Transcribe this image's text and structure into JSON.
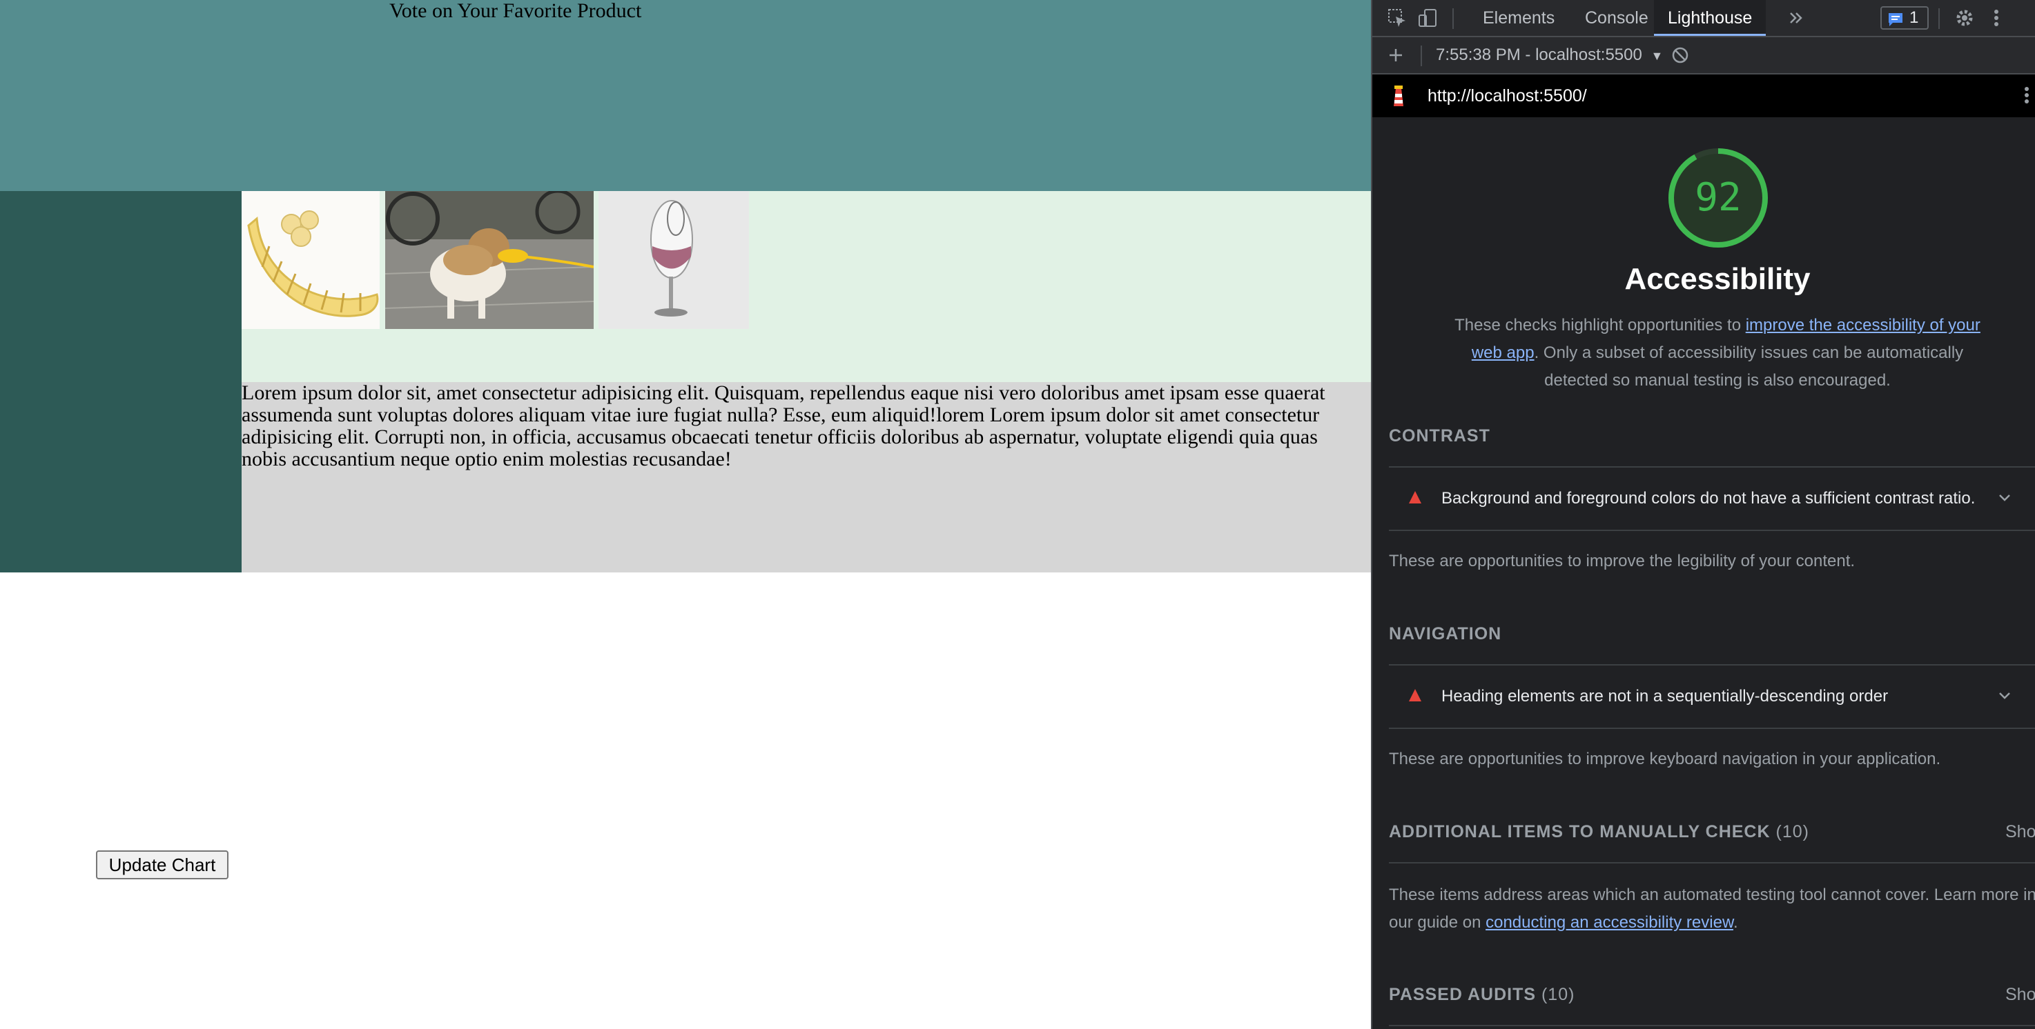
{
  "page": {
    "header_title": "Vote on Your Favorite Product",
    "products": [
      {
        "name": "banana-slicer-image",
        "icon": "banana-slicer-product-photo"
      },
      {
        "name": "duck-bill-dog-image",
        "icon": "dog-with-duck-bill-muzzle-photo"
      },
      {
        "name": "wine-glass-image",
        "icon": "tilted-wine-glass-product-photo"
      }
    ],
    "body_text": "Lorem ipsum dolor sit, amet consectetur adipisicing elit. Quisquam, repellendus eaque nisi vero doloribus amet ipsam esse quaerat assumenda sunt voluptas dolores aliquam vitae iure fugiat nulla? Esse, eum aliquid!lorem Lorem ipsum dolor sit amet consectetur adipisicing elit. Corrupti non, in officia, accusamus obcaecati tenetur officiis doloribus ab aspernatur, voluptate eligendi quia quas nobis accusantium neque optio enim molestias recusandae!",
    "update_button": "Update Chart",
    "colors": {
      "header": "#558d8f",
      "side": "#2d5a56",
      "gallery": "#e1f2e5",
      "text_bg": "#d6d6d6"
    }
  },
  "devtools": {
    "tabs": [
      "Elements",
      "Console",
      "Lighthouse"
    ],
    "active_tab": "Lighthouse",
    "more_tabs_icon": "double-chevron-right-icon",
    "issues_count": "1",
    "report_selector": "7:55:38 PM - localhost:5500",
    "url": "http://localhost:5500/",
    "category": {
      "score": "92",
      "score_fraction": 0.92,
      "title": "Accessibility",
      "description_before": "These checks highlight opportunities to ",
      "description_link": "improve the accessibility of your web app",
      "description_after": ". Only a subset of accessibility issues can be automatically detected so manual testing is also encouraged."
    },
    "groups": {
      "contrast": {
        "title": "CONTRAST",
        "audit": "Background and foreground colors do not have a sufficient contrast ratio.",
        "description": "These are opportunities to improve the legibility of your content."
      },
      "navigation": {
        "title": "NAVIGATION",
        "audit": "Heading elements are not in a sequentially-descending order",
        "description": "These are opportunities to improve keyboard navigation in your application."
      },
      "manual": {
        "title": "ADDITIONAL ITEMS TO MANUALLY CHECK",
        "count": "(10)",
        "show": "Show",
        "description_line1": "These items address areas which an automated testing tool cannot cover. Learn more in",
        "description_line2_before": "our guide on ",
        "description_link": "conducting an accessibility review",
        "description_line2_after": "."
      },
      "passed": {
        "title": "PASSED AUDITS",
        "count": "(10)",
        "show": "Show"
      }
    },
    "colors": {
      "score": "#3fb950",
      "fail": "#e8453c",
      "link": "#8ab4f8",
      "bg": "#202124"
    }
  }
}
